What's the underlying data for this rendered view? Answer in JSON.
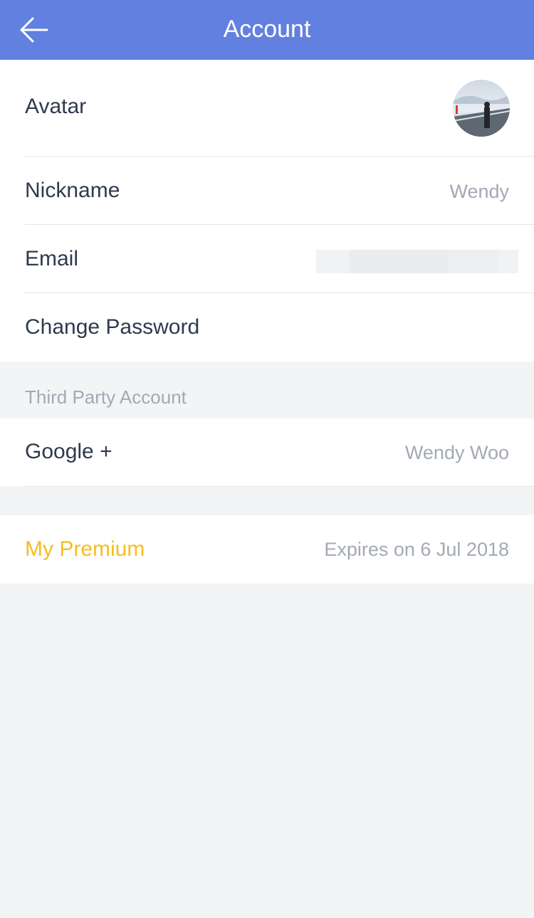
{
  "header": {
    "title": "Account",
    "back_icon": "arrow-left-icon",
    "background": "#6280e0"
  },
  "profile": {
    "avatar": {
      "label": "Avatar",
      "icon": "avatar-photo"
    },
    "nickname": {
      "label": "Nickname",
      "value": "Wendy"
    },
    "email": {
      "label": "Email"
    },
    "password": {
      "label": "Change Password"
    }
  },
  "third_party": {
    "title": "Third Party Account",
    "google": {
      "label": "Google +",
      "value": "Wendy Woo"
    }
  },
  "premium": {
    "label": "My Premium",
    "value": "Expires on 6 Jul 2018",
    "accent": "#f5be1c"
  }
}
